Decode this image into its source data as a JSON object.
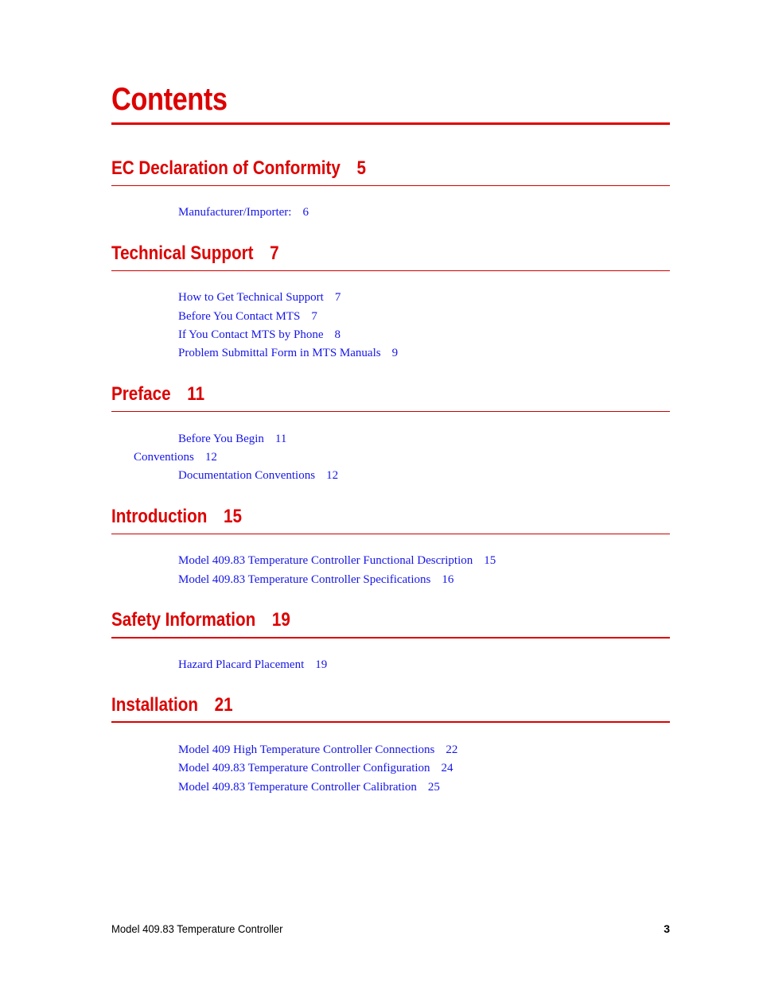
{
  "page": {
    "title": "Contents",
    "accent_color": "#dd0000",
    "link_color": "#1515e8"
  },
  "chapters": [
    {
      "title": "EC Declaration of Conformity",
      "page": "5",
      "entries": [
        {
          "title": "Manufacturer/Importer:",
          "page": "6",
          "level": 2
        }
      ]
    },
    {
      "title": "Technical Support",
      "page": "7",
      "entries": [
        {
          "title": "How to Get Technical Support",
          "page": "7",
          "level": 2
        },
        {
          "title": "Before You Contact MTS",
          "page": "7",
          "level": 2
        },
        {
          "title": "If You Contact MTS by Phone",
          "page": "8",
          "level": 2
        },
        {
          "title": "Problem Submittal Form in MTS Manuals",
          "page": "9",
          "level": 2
        }
      ]
    },
    {
      "title": "Preface",
      "page": "11",
      "entries": [
        {
          "title": "Before You Begin",
          "page": "11",
          "level": 2
        },
        {
          "title": "Conventions",
          "page": "12",
          "level": 1
        },
        {
          "title": "Documentation Conventions",
          "page": "12",
          "level": 2
        }
      ]
    },
    {
      "title": "Introduction",
      "page": "15",
      "entries": [
        {
          "title": "Model 409.83 Temperature Controller Functional Description",
          "page": "15",
          "level": 2
        },
        {
          "title": "Model 409.83 Temperature Controller Specifications",
          "page": "16",
          "level": 2
        }
      ]
    },
    {
      "title": "Safety Information",
      "page": "19",
      "entries": [
        {
          "title": "Hazard Placard Placement",
          "page": "19",
          "level": 2
        }
      ]
    },
    {
      "title": "Installation",
      "page": "21",
      "entries": [
        {
          "title": "Model 409 High Temperature Controller Connections",
          "page": "22",
          "level": 2
        },
        {
          "title": "Model 409.83 Temperature Controller Configuration",
          "page": "24",
          "level": 2
        },
        {
          "title": "Model 409.83 Temperature Controller Calibration",
          "page": "25",
          "level": 2
        }
      ]
    }
  ],
  "footer": {
    "document_title": "Model 409.83 Temperature Controller",
    "page_number": "3"
  }
}
